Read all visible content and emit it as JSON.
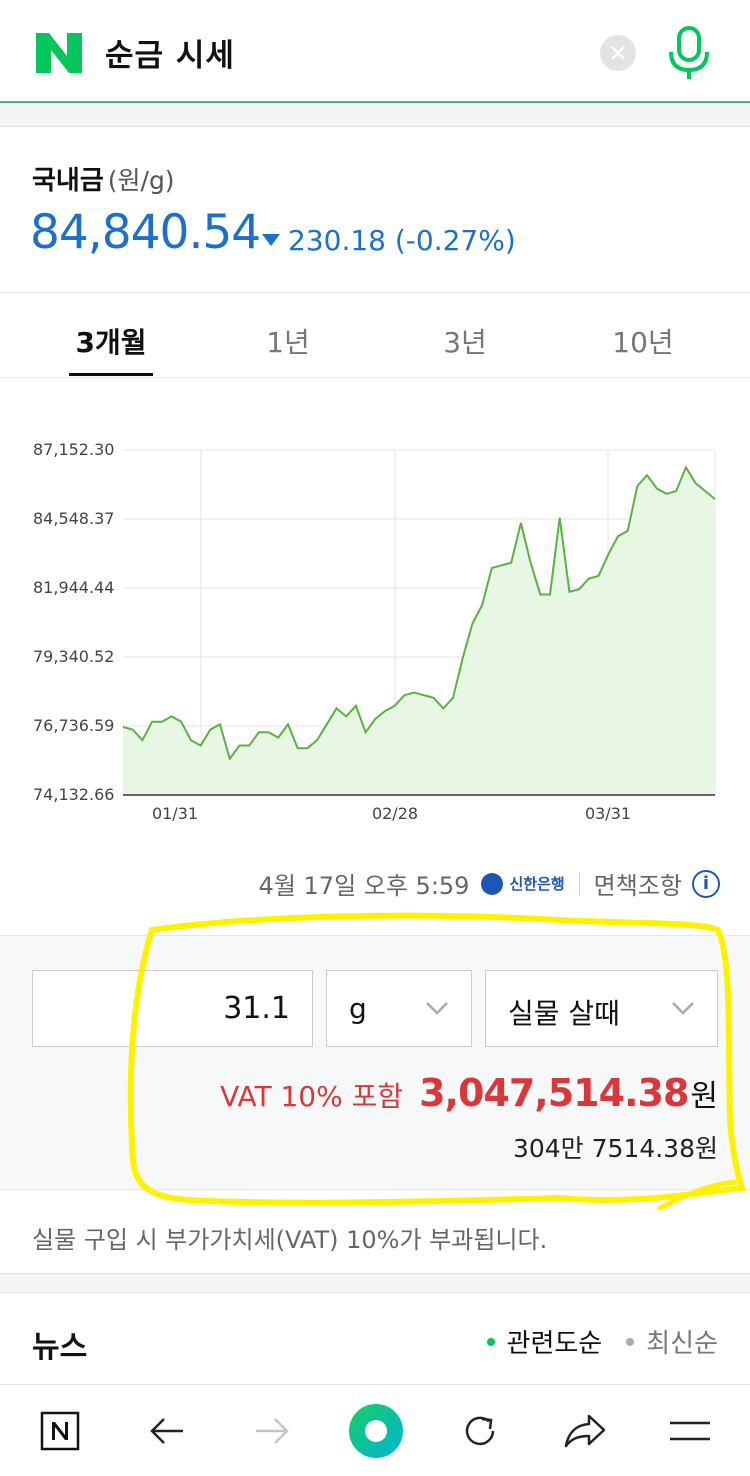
{
  "header": {
    "query": "순금 시세"
  },
  "price": {
    "label": "국내금",
    "unit": "(원/g)",
    "value": "84,840.54",
    "change": "230.18 (-0.27%)"
  },
  "tabs": [
    {
      "label": "3개월",
      "active": true
    },
    {
      "label": "1년",
      "active": false
    },
    {
      "label": "3년",
      "active": false
    },
    {
      "label": "10년",
      "active": false
    }
  ],
  "chart_data": {
    "type": "area",
    "y_ticks": [
      "87,152.30",
      "84,548.37",
      "81,944.44",
      "79,340.52",
      "76,736.59",
      "74,132.66"
    ],
    "x_ticks": [
      "01/31",
      "02/28",
      "03/31"
    ],
    "ylim": [
      74132.66,
      87152.3
    ],
    "grid": true,
    "line_color": "#5bb044",
    "fill_color": "#e8f7e3",
    "values": [
      76700,
      76600,
      76200,
      76900,
      76900,
      77100,
      76900,
      76200,
      76000,
      76600,
      76800,
      75500,
      76000,
      76000,
      76500,
      76500,
      76300,
      76800,
      75900,
      75900,
      76200,
      76800,
      77400,
      77100,
      77500,
      76500,
      77000,
      77300,
      77500,
      77900,
      78000,
      77900,
      77800,
      77400,
      77800,
      79300,
      80600,
      81300,
      82700,
      82800,
      82900,
      84400,
      82900,
      81700,
      81700,
      84600,
      81800,
      81900,
      82300,
      82400,
      83200,
      83900,
      84100,
      85800,
      86200,
      85700,
      85500,
      85600,
      86500,
      85900,
      85600,
      85300
    ]
  },
  "info": {
    "timestamp": "4월 17일 오후 5:59",
    "bank": "신한은행",
    "disclaimer": "면책조항"
  },
  "calculator": {
    "quantity": "31.1",
    "unit": "g",
    "type": "실물 살때",
    "vat_label": "VAT 10% 포함",
    "total": "3,047,514.38",
    "currency": "원",
    "korean_amount": "304만 7514.38원"
  },
  "notice": "실물 구입 시 부가가치세(VAT) 10%가 부과됩니다.",
  "news": {
    "title": "뉴스",
    "sort_relevance": "관련도순",
    "sort_latest": "최신순"
  },
  "colors": {
    "accent_green": "#03c75a",
    "price_blue": "#1e6fc6",
    "alert_red": "#d9373a",
    "highlight_yellow": "#fff200"
  }
}
